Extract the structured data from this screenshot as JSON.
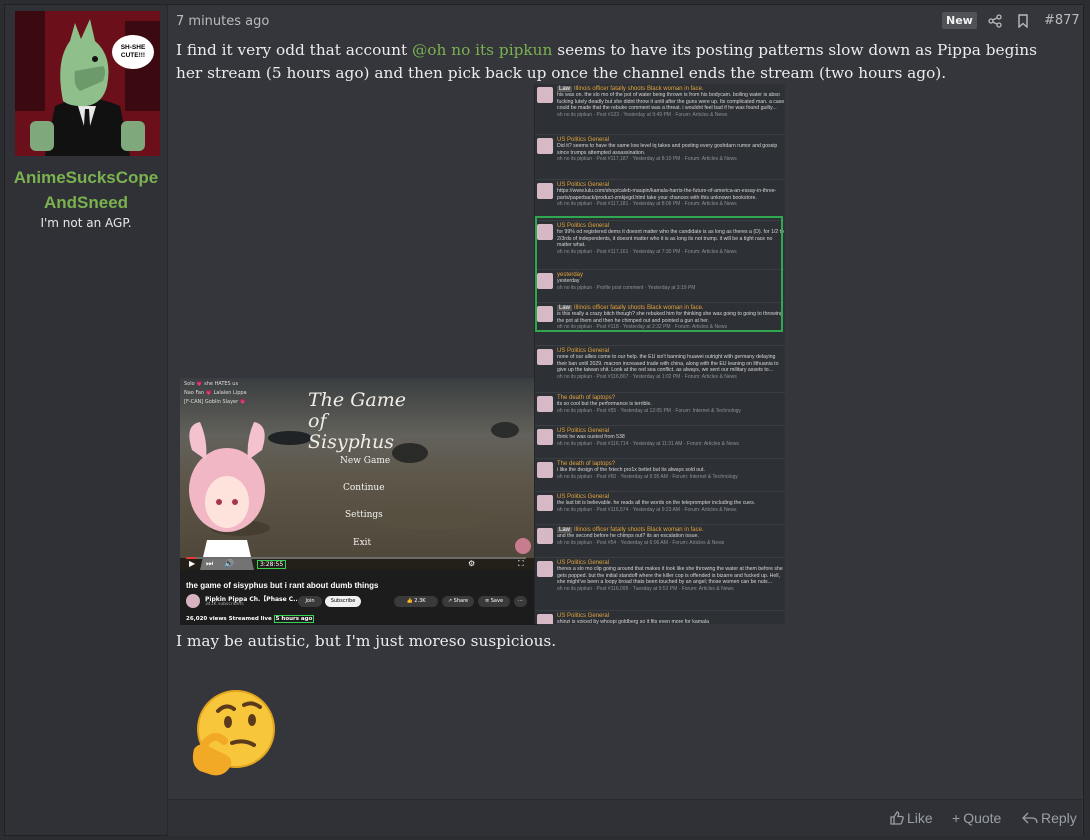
{
  "user": {
    "name": "AnimeSucksCopeAndSneed",
    "title": "I'm not an AGP.",
    "avatar_bubble": "SH-SHE CUTE!!!"
  },
  "post": {
    "time": "7 minutes ago",
    "badge": "New",
    "number": "#877",
    "text_before": "I find it very odd that account ",
    "mention": "@oh no its pipkun",
    "text_after": " seems to have its posting patterns slow down as Pippa begins her stream (5 hours ago) and then pick back up once the channel ends the stream (two hours ago).",
    "closing": "I may be autistic, but I'm just moreso suspicious."
  },
  "activity_items": [
    {
      "title": "Illinois officer fatally shoots Black woman in face.",
      "tag": "Law",
      "text": "his was on. the slo mo of the pot of water being thrown is from his bodycam. boiling water is abso fucking lutely deadly but she didnt throw it until after the guns were up. Its complicated man. a case could be made that the rebuke comment was a threat. i wouldnt feel bad if he was found guilty...",
      "meta": "oh no its pipkun · Post #133 · Yesterday at 9:49 PM · Forum: Articles & News"
    },
    {
      "title": "US Politics General",
      "tag": "",
      "text": "Did it? seems to have the same low level iq takes and posting every goshdarn rumor and gossip since trumps attempted assassination.",
      "meta": "oh no its pipkun · Post #117,187 · Yesterday at 8:10 PM · Forum: Articles & News"
    },
    {
      "title": "US Politics General",
      "tag": "",
      "text": "https://www.lulu.com/shop/caleb-maupin/kamala-harris-the-future-of-america-an-essay-in-three-parts/paperback/product-zmkjegd.html take your chances with this unknown bookstore.",
      "meta": "oh no its pipkun · Post #117,181 · Yesterday at 8:06 PM · Forum: Articles & News"
    },
    {
      "title": "US Politics General",
      "tag": "",
      "text": "for 99% od registered dems it doesnt matter who the candidate is as long as theres a (D). for 1/2 to 2/3rds of independents, it doesnt matter who it is as long its not trump. it will be a tight race no matter what.",
      "meta": "oh no its pipkun · Post #117,161 · Yesterday at 7:30 PM · Forum: Articles & News"
    },
    {
      "title": "yesterday",
      "tag": "",
      "text": "yesterday",
      "meta": "oh no its pipkun · Profile post comment · Yesterday at 3:19 PM"
    },
    {
      "title": "Illinois officer fatally shoots Black woman in face.",
      "tag": "Law",
      "text": "is this really a crazy bitch though? she rebuked him for thinking she was going to going to throwing the pot at them and then he chimped out and pointed a gun at her.",
      "meta": "oh no its pipkun · Post #118 · Yesterday at 2:32 PM · Forum: Articles & News"
    },
    {
      "title": "US Politics General",
      "tag": "",
      "text": "none of our allies come to our help. the EU isn't banning huawei outright with germany delaying their ban until 2029. macron increased trade with china, along with the EU leaning on lithuania to give up the taiwan shit. Look at the red sea conflict. as always, we sent our military assets to...",
      "meta": "oh no its pipkun · Post #116,807 · Yesterday at 1:02 PM · Forum: Articles & News"
    },
    {
      "title": "The death of laptops?",
      "tag": "",
      "text": "its so cool but the performance is terrible.",
      "meta": "oh no its pipkun · Post #55 · Yesterday at 12:05 PM · Forum: Internet & Technology"
    },
    {
      "title": "US Politics General",
      "tag": "",
      "text": "think he was ousted from 538",
      "meta": "oh no its pipkun · Post #116,714 · Yesterday at 11:31 AM · Forum: Articles & News"
    },
    {
      "title": "The death of laptops?",
      "tag": "",
      "text": "i like the design of the fxtech pro1x bettet but its always sold out.",
      "meta": "oh no its pipkun · Post #50 · Yesterday at 9:35 AM · Forum: Internet & Technology"
    },
    {
      "title": "US Politics General",
      "tag": "",
      "text": "the last bit is believable. he reads all the words on the teleprompter including the cues.",
      "meta": "oh no its pipkun · Post #116,574 · Yesterday at 9:23 AM · Forum: Articles & News"
    },
    {
      "title": "Illinois officer fatally shoots Black woman in face.",
      "tag": "Law",
      "text": "and the second before he chimps out? its an escalation issue.",
      "meta": "oh no its pipkun · Post #54 · Yesterday at 6:06 AM · Forum: Articles & News"
    },
    {
      "title": "US Politics General",
      "tag": "",
      "text": "theres a slo mo clip going around that makes it look like she throwing the water at them before she gets popped. but the initial standoff where the killer cop is offended is bizarre and fucked up. Hell, she might've been a loopy broad thats been touched by an angel; those women can be nuts...",
      "meta": "oh no its pipkun · Post #116,095 · Tuesday at 9:52 PM · Forum: Articles & News"
    },
    {
      "title": "US Politics General",
      "tag": "",
      "text": "shinzi is voiced by whoopi goldberg so it fits even more for kamala",
      "meta": "oh no its pipkun · Post #116,085 · Tuesday at 9:44 PM · Forum: Articles & News"
    }
  ],
  "video": {
    "game_title": "The Game of Sisyphus",
    "menu": [
      "New Game",
      "Continue",
      "Settings",
      "Exit"
    ],
    "chat": [
      "Solo 💗 she HATES us",
      "Nao Fan 💗 Lalalen Lippa",
      "[F-CAN] Goblin Slayer 💗"
    ],
    "time": "3:28:55",
    "progress": 0.03,
    "title": "the game of sisyphus but i rant about dumb things",
    "channel": "Pipkin Pippa Ch.【Phase C...",
    "subs": "341K subscribers",
    "join": "Join",
    "subscribe": "Subscribe",
    "likes": "2.3K",
    "share": "Share",
    "save": "Save",
    "views_prefix": "26,020 views  Streamed live ",
    "views_highlight": "5 hours ago"
  },
  "actions": {
    "like": "Like",
    "quote": "Quote",
    "reply": "Reply"
  },
  "colors": {
    "accent_green": "#7bb24f",
    "highlight_green": "#2fa84f",
    "thread_orange": "#e0a33e"
  }
}
